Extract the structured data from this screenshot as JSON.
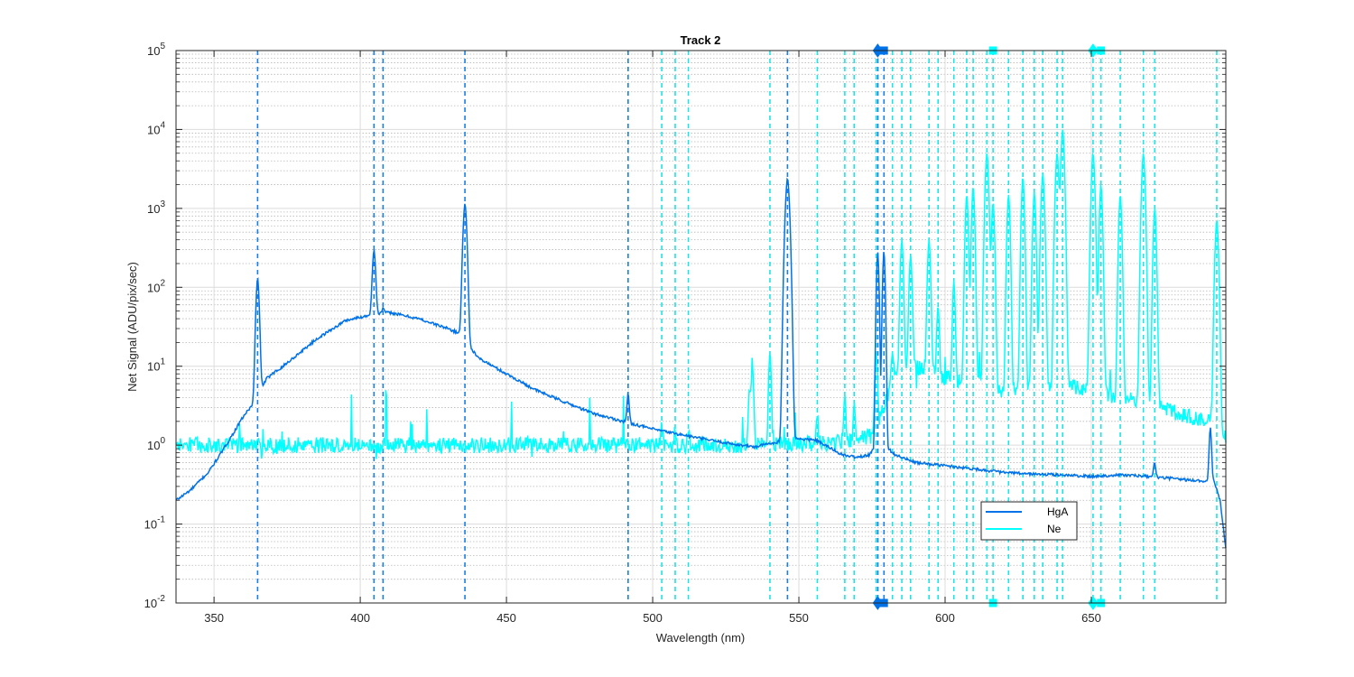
{
  "chart_data": {
    "type": "line",
    "title": "Track 2",
    "xlabel": "Wavelength (nm)",
    "ylabel": "Net Signal (ADU/pix/sec)",
    "xlim": [
      337,
      696
    ],
    "ylim": [
      0.01,
      100000
    ],
    "yscale": "log",
    "grid": true,
    "x_ticks": [
      350,
      400,
      450,
      500,
      550,
      600,
      650
    ],
    "x_tick_labels": [
      "350",
      "400",
      "450",
      "500",
      "550",
      "600",
      "650"
    ],
    "y_ticks": [
      0.01,
      0.1,
      1,
      10,
      100,
      1000,
      10000,
      100000
    ],
    "y_tick_labels": [
      {
        "base": "10",
        "exp": "-2"
      },
      {
        "base": "10",
        "exp": "-1"
      },
      {
        "base": "10",
        "exp": "0"
      },
      {
        "base": "10",
        "exp": "1"
      },
      {
        "base": "10",
        "exp": "2"
      },
      {
        "base": "10",
        "exp": "3"
      },
      {
        "base": "10",
        "exp": "4"
      },
      {
        "base": "10",
        "exp": "5"
      }
    ],
    "legend": {
      "placement": "bottom-right",
      "entries": [
        "HgA",
        "Ne"
      ]
    },
    "colors": {
      "HgA": "#0072e8",
      "Ne": "#00ffff",
      "hga_lines": "#1a7fe6",
      "ne_lines": "#19e6e6"
    },
    "series": [
      {
        "name": "HgA",
        "color": "#0072e8",
        "baseline": [
          [
            337,
            0.2
          ],
          [
            342,
            0.27
          ],
          [
            348,
            0.45
          ],
          [
            352,
            0.75
          ],
          [
            356,
            1.3
          ],
          [
            360,
            2.3
          ],
          [
            363,
            3.2
          ],
          [
            368,
            7
          ],
          [
            375,
            11
          ],
          [
            385,
            22
          ],
          [
            395,
            38
          ],
          [
            404,
            45
          ],
          [
            410,
            48
          ],
          [
            420,
            40
          ],
          [
            430,
            30
          ],
          [
            435,
            25
          ],
          [
            440,
            13
          ],
          [
            450,
            8
          ],
          [
            460,
            5
          ],
          [
            470,
            3.5
          ],
          [
            480,
            2.5
          ],
          [
            490,
            2.0
          ],
          [
            500,
            1.6
          ],
          [
            510,
            1.35
          ],
          [
            520,
            1.15
          ],
          [
            530,
            1.0
          ],
          [
            535,
            0.95
          ],
          [
            540,
            1.05
          ],
          [
            550,
            1.2
          ],
          [
            556,
            1.15
          ],
          [
            560,
            0.95
          ],
          [
            565,
            0.75
          ],
          [
            570,
            0.7
          ],
          [
            574,
            0.75
          ],
          [
            578,
            1.1
          ],
          [
            583,
            0.75
          ],
          [
            590,
            0.6
          ],
          [
            600,
            0.55
          ],
          [
            610,
            0.5
          ],
          [
            620,
            0.45
          ],
          [
            630,
            0.43
          ],
          [
            640,
            0.42
          ],
          [
            650,
            0.4
          ],
          [
            660,
            0.42
          ],
          [
            670,
            0.4
          ],
          [
            680,
            0.37
          ],
          [
            688,
            0.35
          ],
          [
            692,
            0.35
          ],
          [
            694,
            0.2
          ],
          [
            696,
            0.05
          ]
        ],
        "peaks": [
          {
            "x": 364.9,
            "peak": 130,
            "width": 0.8
          },
          {
            "x": 404.7,
            "peak": 300,
            "width": 0.8
          },
          {
            "x": 407.8,
            "peak": 55,
            "width": 0.6
          },
          {
            "x": 435.8,
            "peak": 1150,
            "width": 0.9
          },
          {
            "x": 491.6,
            "peak": 4.5,
            "width": 0.6
          },
          {
            "x": 546.1,
            "peak": 2400,
            "width": 1.0
          },
          {
            "x": 576.96,
            "peak": 280,
            "width": 0.6
          },
          {
            "x": 579.07,
            "peak": 290,
            "width": 0.6
          },
          {
            "x": 671.6,
            "peak": 0.6,
            "width": 0.6
          },
          {
            "x": 690.7,
            "peak": 1.7,
            "width": 0.6
          }
        ]
      },
      {
        "name": "Ne",
        "color": "#00ffff",
        "baseline": [
          [
            337,
            1.0
          ],
          [
            530,
            1.0
          ],
          [
            560,
            1.05
          ],
          [
            575,
            1.3
          ],
          [
            580,
            4
          ],
          [
            583,
            8
          ],
          [
            590,
            10
          ],
          [
            600,
            7
          ],
          [
            610,
            6
          ],
          [
            620,
            5
          ],
          [
            630,
            5
          ],
          [
            640,
            6
          ],
          [
            650,
            5
          ],
          [
            660,
            4
          ],
          [
            670,
            3.5
          ],
          [
            680,
            2.5
          ],
          [
            688,
            2
          ],
          [
            692,
            2.5
          ],
          [
            696,
            1.2
          ]
        ],
        "peaks": [
          {
            "x": 503.1,
            "peak": 1.8,
            "width": 0.5
          },
          {
            "x": 507.7,
            "peak": 1.6,
            "width": 0.5
          },
          {
            "x": 512.2,
            "peak": 1.6,
            "width": 0.5
          },
          {
            "x": 533.1,
            "peak": 5,
            "width": 0.6
          },
          {
            "x": 534.1,
            "peak": 10,
            "width": 0.6
          },
          {
            "x": 540.1,
            "peak": 15,
            "width": 0.6
          },
          {
            "x": 556.3,
            "peak": 2.5,
            "width": 0.5
          },
          {
            "x": 565.7,
            "peak": 4.5,
            "width": 0.5
          },
          {
            "x": 568.9,
            "peak": 3.5,
            "width": 0.5
          },
          {
            "x": 576.4,
            "peak": 15,
            "width": 0.6
          },
          {
            "x": 582.0,
            "peak": 15,
            "width": 0.6
          },
          {
            "x": 585.2,
            "peak": 400,
            "width": 0.7
          },
          {
            "x": 588.2,
            "peak": 250,
            "width": 0.7
          },
          {
            "x": 594.5,
            "peak": 400,
            "width": 0.7
          },
          {
            "x": 597.6,
            "peak": 60,
            "width": 0.6
          },
          {
            "x": 603.0,
            "peak": 120,
            "width": 0.6
          },
          {
            "x": 607.4,
            "peak": 1500,
            "width": 0.7
          },
          {
            "x": 609.6,
            "peak": 1900,
            "width": 0.7
          },
          {
            "x": 614.3,
            "peak": 5000,
            "width": 0.8
          },
          {
            "x": 616.4,
            "peak": 1200,
            "width": 0.7
          },
          {
            "x": 621.7,
            "peak": 1500,
            "width": 0.7
          },
          {
            "x": 626.6,
            "peak": 2500,
            "width": 0.7
          },
          {
            "x": 630.5,
            "peak": 1600,
            "width": 0.7
          },
          {
            "x": 633.4,
            "peak": 2700,
            "width": 0.8
          },
          {
            "x": 638.3,
            "peak": 5000,
            "width": 0.8
          },
          {
            "x": 640.2,
            "peak": 10000,
            "width": 0.8
          },
          {
            "x": 650.6,
            "peak": 5000,
            "width": 0.8
          },
          {
            "x": 653.3,
            "peak": 2000,
            "width": 0.7
          },
          {
            "x": 659.9,
            "peak": 1500,
            "width": 0.7
          },
          {
            "x": 667.8,
            "peak": 5000,
            "width": 0.8
          },
          {
            "x": 671.7,
            "peak": 1000,
            "width": 0.7
          },
          {
            "x": 692.9,
            "peak": 700,
            "width": 0.8
          }
        ]
      }
    ],
    "reference_lines": {
      "HgA": [
        364.9,
        404.7,
        407.8,
        435.8,
        491.6,
        546.1,
        577.0,
        579.1
      ],
      "Ne": [
        503.1,
        507.7,
        512.2,
        540.1,
        556.3,
        565.7,
        568.9,
        576.4,
        582.0,
        585.2,
        588.2,
        594.5,
        597.6,
        603.0,
        607.4,
        609.6,
        614.3,
        616.4,
        621.7,
        626.6,
        630.5,
        633.4,
        638.3,
        640.2,
        650.6,
        653.3,
        659.9,
        667.8,
        671.7,
        692.9
      ]
    },
    "edge_markers": [
      {
        "x": 576.96,
        "shape": "diamond",
        "series": "HgA"
      },
      {
        "x": 579.07,
        "shape": "square",
        "series": "HgA"
      },
      {
        "x": 616.4,
        "shape": "square",
        "series": "Ne"
      },
      {
        "x": 650.6,
        "shape": "diamond",
        "series": "Ne"
      },
      {
        "x": 653.3,
        "shape": "square",
        "series": "Ne"
      }
    ]
  }
}
